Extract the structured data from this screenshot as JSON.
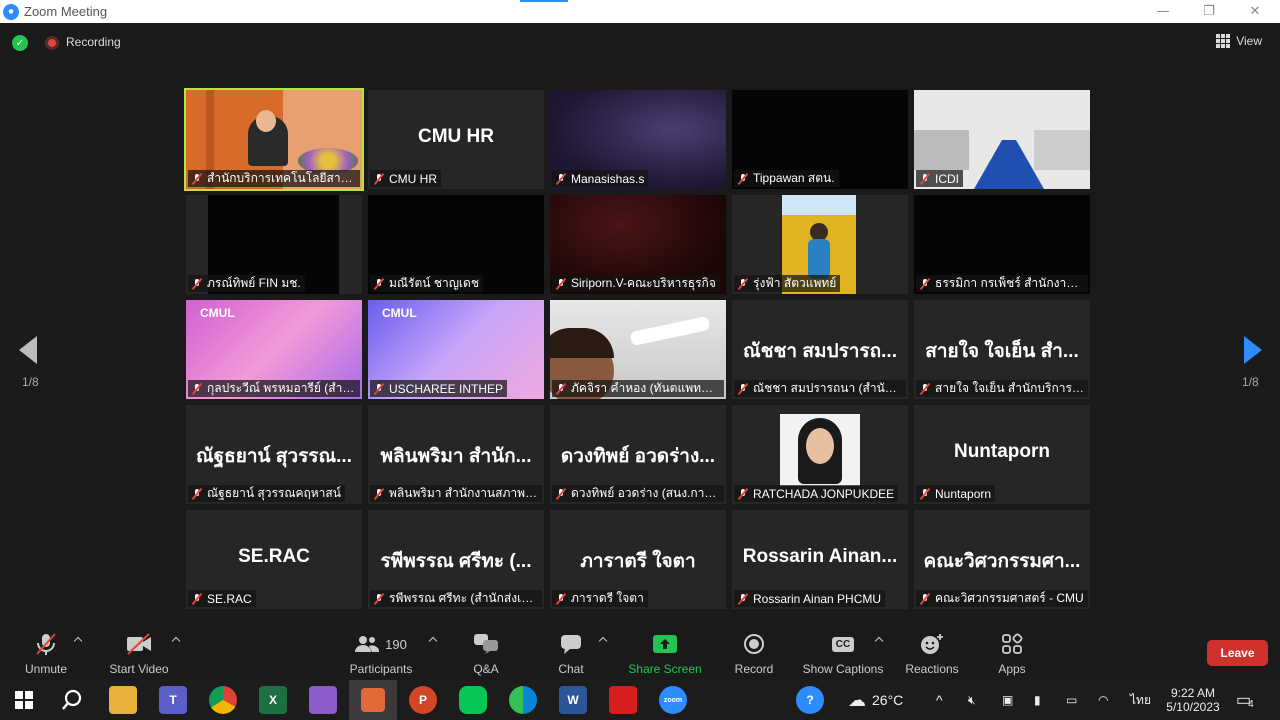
{
  "window": {
    "title": "Zoom Meeting"
  },
  "meeting_bar": {
    "recording_label": "Recording",
    "view_label": "View"
  },
  "page_indicator": "1/8",
  "tiles": [
    {
      "label": "สำนักบริการเทคโนโลยีสารสนเทศ",
      "big": "",
      "kind": "video-stage",
      "active": true
    },
    {
      "label": "CMU HR",
      "big": "CMU HR",
      "kind": "name"
    },
    {
      "label": "Manasishas.s",
      "big": "",
      "kind": "video-dark-purple"
    },
    {
      "label": "Tippawan สตน.",
      "big": "",
      "kind": "video-black"
    },
    {
      "label": "ICDI",
      "big": "",
      "kind": "video-classroom"
    },
    {
      "label": "ภรณ์ทิพย์ FIN มช.",
      "big": "",
      "kind": "video-pillar"
    },
    {
      "label": "มณีรัตน์ ชาญเดช",
      "big": "",
      "kind": "video-black"
    },
    {
      "label": "Siriporn.V-คณะบริหารธุรกิจ",
      "big": "",
      "kind": "video-dark-red"
    },
    {
      "label": "รุ่งฟ้า สัตวแพทย์",
      "big": "",
      "kind": "video-sunflower"
    },
    {
      "label": "ธรรมิกา กรเพ็ชร์ สำนักงานการ...",
      "big": "",
      "kind": "video-black"
    },
    {
      "label": "กุลประวีณ์ พรหมอารีย์ (สำนัก...",
      "big": "",
      "kind": "video-cmul-pink"
    },
    {
      "label": "USCHAREE INTHEP",
      "big": "",
      "kind": "video-cmul-purple"
    },
    {
      "label": "ภัคจิรา คำหอง (ทันตแพทยศา...",
      "big": "",
      "kind": "video-face"
    },
    {
      "label": "ณัชชา สมปรารถนา (สำนักหอ...",
      "big": "ณัชชา สมปรารถ...",
      "kind": "name"
    },
    {
      "label": "สายใจ ใจเย็น สำนักบริการเท...",
      "big": "สายใจ ใจเย็น สำ...",
      "kind": "name"
    },
    {
      "label": "ณัฐธยาน์ สุวรรณคฤหาสน์",
      "big": "ณัฐธยาน์ สุวรรณ...",
      "kind": "name"
    },
    {
      "label": "พลินพริมา สำนักงานสภาพนัก...",
      "big": "พลินพริมา สำนัก...",
      "kind": "name"
    },
    {
      "label": "ดวงทิพย์ อวดร่าง (สนง.การตร...",
      "big": "ดวงทิพย์ อวดร่าง...",
      "kind": "name"
    },
    {
      "label": "RATCHADA JONPUKDEE",
      "big": "",
      "kind": "video-portrait"
    },
    {
      "label": "Nuntaporn",
      "big": "Nuntaporn",
      "kind": "name"
    },
    {
      "label": "SE.RAC",
      "big": "SE.RAC",
      "kind": "name"
    },
    {
      "label": "รพีพรรณ ศรีทะ (สำนักส่งเสริม...",
      "big": "รพีพรรณ ศรีทะ (...",
      "kind": "name"
    },
    {
      "label": "ภาราดรี ใจตา",
      "big": "ภาราตรี ใจตา",
      "kind": "name"
    },
    {
      "label": "Rossarin Ainan PHCMU",
      "big": "Rossarin Ainan...",
      "kind": "name"
    },
    {
      "label": "คณะวิศวกรรมศาสตร์ - CMU",
      "big": "คณะวิศวกรรมศา...",
      "kind": "name"
    }
  ],
  "toolbar": {
    "unmute": "Unmute",
    "start_video": "Start Video",
    "participants": "Participants",
    "participants_count": "190",
    "qa": "Q&A",
    "chat": "Chat",
    "share": "Share Screen",
    "record": "Record",
    "captions": "Show Captions",
    "captions_icon_text": "CC",
    "reactions": "Reactions",
    "apps": "Apps",
    "leave": "Leave"
  },
  "taskbar": {
    "temperature": "26°C",
    "language": "ไทย",
    "time": "9:22 AM",
    "date": "5/10/2023",
    "notifications": "4",
    "zoom_icon_text": "zoom",
    "excel_icon_text": "X",
    "word_icon_text": "W",
    "ppt_icon_text": "P"
  }
}
